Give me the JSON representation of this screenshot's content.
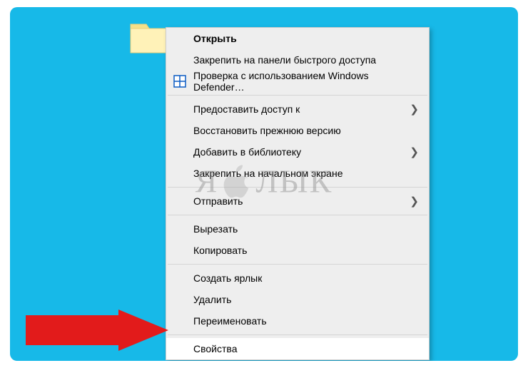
{
  "watermark": {
    "text_left": "Я",
    "text_right": "ЛЫК"
  },
  "menu": {
    "open": "Открыть",
    "pin_quick": "Закрепить на панели быстрого доступа",
    "defender": "Проверка с использованием Windows Defender…",
    "grant_access": "Предоставить доступ к",
    "restore_prev": "Восстановить прежнюю версию",
    "add_library": "Добавить в библиотеку",
    "pin_start": "Закрепить на начальном экране",
    "send_to": "Отправить",
    "cut": "Вырезать",
    "copy": "Копировать",
    "create_shortcut": "Создать ярлык",
    "delete": "Удалить",
    "rename": "Переименовать",
    "properties": "Свойства"
  }
}
